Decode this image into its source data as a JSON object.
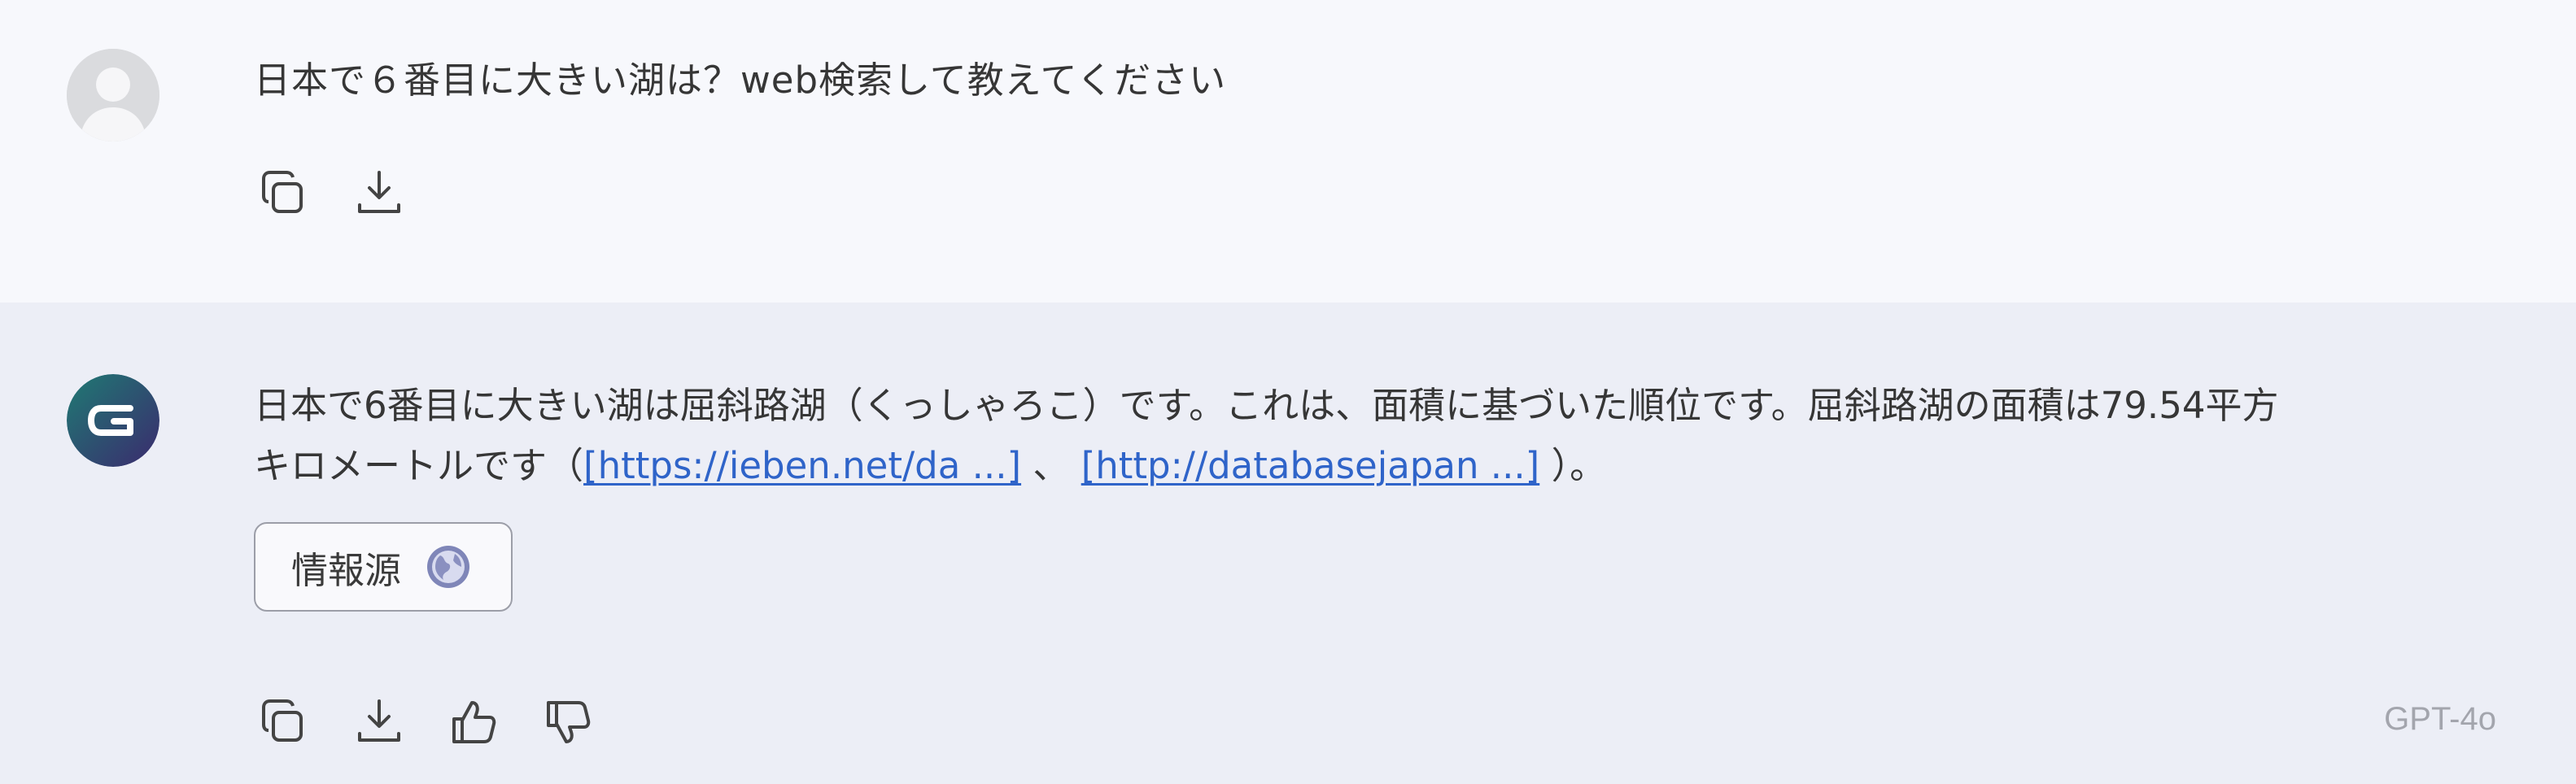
{
  "user_message": {
    "text": "日本で６番目に大きい湖は？web検索して教えてください",
    "actions": [
      "copy-icon",
      "download-icon"
    ]
  },
  "assistant_message": {
    "text_before": "日本で6番目に大きい湖は屈斜路湖（くっしゃろこ）です。これは、面積に基づいた順位です。屈斜路湖の面積は79.54平方",
    "text_line2_start": "キロメートルです（",
    "link1": "[https://ieben.net/da ...]",
    "separator": " 、",
    "link2": "[http://databasejapan ...]",
    "text_end": "）。",
    "source_button_label": "情報源",
    "actions": [
      "copy-icon",
      "download-icon",
      "thumbs-up-icon",
      "thumbs-down-icon"
    ],
    "model_label": "GPT-4o"
  },
  "colors": {
    "user_bg": "#f7f8fc",
    "assistant_bg": "#eceef6",
    "link": "#2f64c9",
    "avatar_gradient_start": "#1f6f72",
    "avatar_gradient_end": "#3b2a6e"
  }
}
